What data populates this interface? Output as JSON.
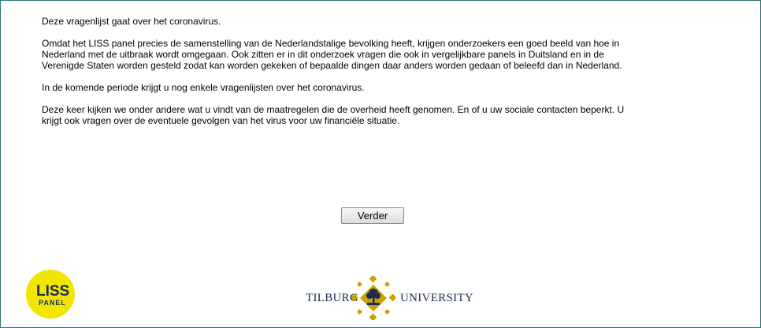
{
  "survey": {
    "paragraphs": [
      "Deze vragenlijst gaat over het coronavirus.",
      "Omdat het LISS panel precies de samenstelling van de Nederlandstalige bevolking heeft, krijgen onderzoekers een goed beeld van hoe in Nederland met de uitbraak wordt omgegaan. Ook zitten er in dit onderzoek vragen die ook in vergelijkbare panels in Duitsland en in de Verenigde Staten worden gesteld zodat kan worden gekeken of bepaalde dingen daar anders worden gedaan of beleefd dan in Nederland.",
      "In de komende periode krijgt u nog enkele vragenlijsten over het coronavirus.",
      "Deze keer kijken we onder andere wat u vindt van de maatregelen die de overheid heeft genomen. En of u uw sociale contacten beperkt. U krijgt ook vragen over de eventuele gevolgen van het virus voor uw financiële situatie."
    ]
  },
  "navigation": {
    "next_label": "Verder"
  },
  "footer": {
    "liss_logo": {
      "line1": "LISS",
      "line2": "PANEL",
      "color": "#f2e600"
    },
    "tilburg_logo": {
      "left": "TILBURG",
      "right": "UNIVERSITY",
      "seal_color": "#c9a200",
      "text_color": "#1b2d55"
    }
  }
}
